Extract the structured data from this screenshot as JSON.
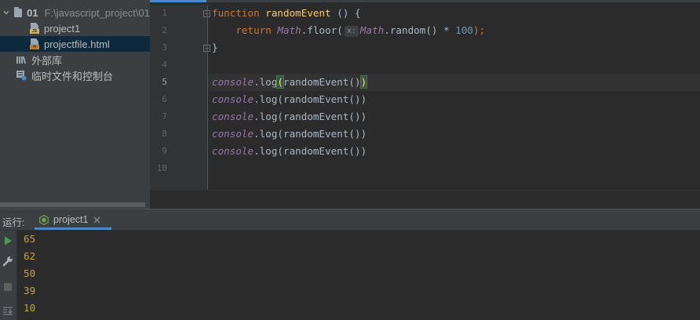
{
  "project_tree": {
    "root": {
      "name": "01",
      "path": "F:\\javascript_project\\01"
    },
    "items": [
      {
        "label": "project1",
        "icon": "js-file-icon"
      },
      {
        "label": "projectfile.html",
        "icon": "html-file-icon",
        "selected": true
      },
      {
        "label": "外部库",
        "icon": "external-libraries-icon"
      },
      {
        "label": "临时文件和控制台",
        "icon": "scratches-icon"
      }
    ]
  },
  "editor": {
    "line_numbers": [
      "1",
      "2",
      "3",
      "4",
      "5",
      "6",
      "7",
      "8",
      "9",
      "10"
    ],
    "current_line": "5",
    "code": {
      "line1": {
        "keyword": "function",
        "name": "randomEvent",
        "rest": " () {"
      },
      "line2": {
        "keyword": "return",
        "obj1": "Math",
        "call1": ".floor(",
        "hint": "x:",
        "obj2": "Math",
        "call2": ".random()",
        "op": " * ",
        "num": "100",
        "end": ");"
      },
      "line3": {
        "text": "}"
      },
      "line4": {
        "text": ""
      },
      "calls": [
        {
          "obj": "console",
          "method": ".log",
          "open": "(",
          "inner": "randomEvent()",
          "close": ")"
        },
        {
          "obj": "console",
          "method": ".log",
          "open": "(",
          "inner": "randomEvent()",
          "close": ")"
        },
        {
          "obj": "console",
          "method": ".log",
          "open": "(",
          "inner": "randomEvent()",
          "close": ")"
        },
        {
          "obj": "console",
          "method": ".log",
          "open": "(",
          "inner": "randomEvent()",
          "close": ")"
        },
        {
          "obj": "console",
          "method": ".log",
          "open": "(",
          "inner": "randomEvent()",
          "close": ")"
        }
      ]
    }
  },
  "run_panel": {
    "label": "运行:",
    "tab": {
      "label": "project1",
      "icon": "nodejs-icon"
    },
    "toolbar": [
      "run-icon",
      "wrench-icon",
      "stop-icon",
      "scroll-to-end-icon"
    ],
    "output": [
      "65",
      "62",
      "50",
      "39",
      "10"
    ]
  },
  "colors": {
    "background": "#2b2b2b",
    "panel": "#3c3f41",
    "keyword": "#cc7832",
    "function_name": "#ffc66d",
    "object": "#9876aa",
    "number": "#6897bb",
    "console_output": "#c7a148",
    "accent": "#4a88c7"
  }
}
